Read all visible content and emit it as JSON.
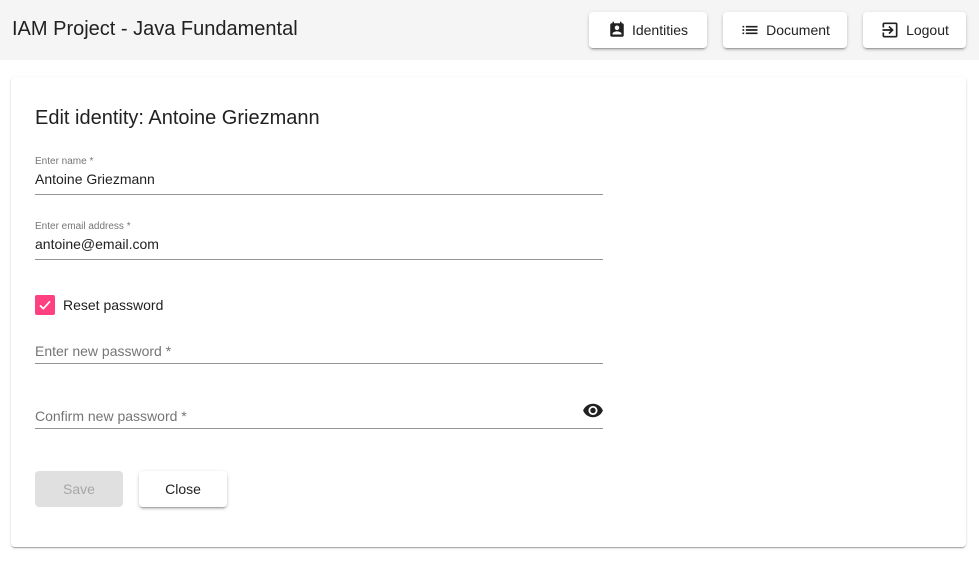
{
  "app": {
    "title": "IAM Project - Java Fundamental"
  },
  "nav": {
    "identities": {
      "label": "Identities",
      "icon": "contact-badge-icon"
    },
    "document": {
      "label": "Document",
      "icon": "list-icon"
    },
    "logout": {
      "label": "Logout",
      "icon": "exit-icon"
    }
  },
  "form": {
    "heading": "Edit identity: Antoine Griezmann",
    "name": {
      "label": "Enter name *",
      "value": "Antoine Griezmann"
    },
    "email": {
      "label": "Enter email address *",
      "value": "antoine@email.com"
    },
    "reset_password": {
      "label": "Reset password",
      "checked": true,
      "color": "#ff4081"
    },
    "new_password": {
      "placeholder": "Enter new password *",
      "value": ""
    },
    "confirm_password": {
      "placeholder": "Confirm new password *",
      "value": "",
      "toggle_icon": "eye-icon"
    },
    "save_label": "Save",
    "save_disabled": true,
    "close_label": "Close"
  }
}
